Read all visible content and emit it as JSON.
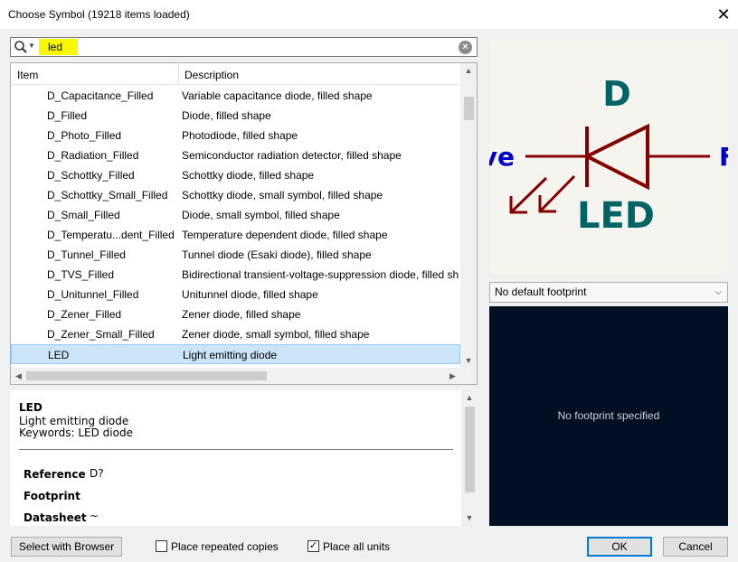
{
  "window": {
    "title": "Choose Symbol (19218 items loaded)",
    "close_glyph": "✕"
  },
  "search": {
    "query": "led",
    "clear_glyph": "×"
  },
  "table": {
    "headers": [
      "Item",
      "Description"
    ],
    "rows": [
      {
        "name": "D_Capacitance_Filled",
        "desc": "Variable capacitance diode, filled shape"
      },
      {
        "name": "D_Filled",
        "desc": "Diode, filled shape"
      },
      {
        "name": "D_Photo_Filled",
        "desc": "Photodiode, filled shape"
      },
      {
        "name": "D_Radiation_Filled",
        "desc": "Semiconductor radiation detector, filled shape"
      },
      {
        "name": "D_Schottky_Filled",
        "desc": "Schottky diode, filled shape"
      },
      {
        "name": "D_Schottky_Small_Filled",
        "desc": "Schottky diode, small symbol, filled shape"
      },
      {
        "name": "D_Small_Filled",
        "desc": "Diode, small symbol, filled shape"
      },
      {
        "name": "D_Temperatu...dent_Filled",
        "desc": "Temperature dependent diode, filled shape"
      },
      {
        "name": "D_Tunnel_Filled",
        "desc": "Tunnel diode (Esaki diode), filled shape"
      },
      {
        "name": "D_TVS_Filled",
        "desc": "Bidirectional transient-voltage-suppression diode, filled sh"
      },
      {
        "name": "D_Unitunnel_Filled",
        "desc": "Unitunnel diode, filled shape"
      },
      {
        "name": "D_Zener_Filled",
        "desc": "Zener diode, filled shape"
      },
      {
        "name": "D_Zener_Small_Filled",
        "desc": "Zener diode, small symbol, filled shape"
      },
      {
        "name": "LED",
        "desc": "Light emitting diode",
        "selected": true
      }
    ]
  },
  "details": {
    "name": "LED",
    "description": "Light emitting diode",
    "keywords": "Keywords: LED diode",
    "fields": [
      {
        "label": "Reference",
        "value": "D?"
      },
      {
        "label": "Footprint",
        "value": ""
      },
      {
        "label": "Datasheet",
        "value": "~"
      }
    ]
  },
  "preview": {
    "ref_text": "D",
    "value_text": "LED",
    "left_pin_text": "ve",
    "right_pin_text": "F",
    "colors": {
      "body": "#840000",
      "text": "#006464",
      "pin_name": "#0000c2",
      "background": "#f5f4ef"
    }
  },
  "footprint": {
    "selected": "No default footprint",
    "empty_message": "No footprint specified"
  },
  "buttons": {
    "select_browser": "Select with Browser",
    "repeated_copies": "Place repeated copies",
    "repeated_checked": false,
    "all_units": "Place all units",
    "all_units_checked": true,
    "ok": "OK",
    "cancel": "Cancel"
  }
}
